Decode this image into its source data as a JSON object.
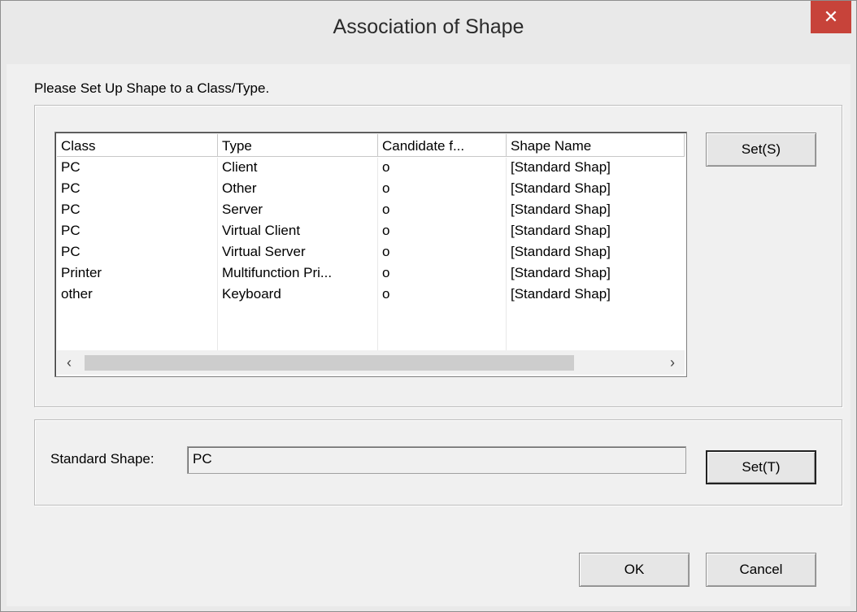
{
  "window": {
    "title": "Association of Shape",
    "close_glyph": "✕"
  },
  "instruction": "Please Set Up Shape to a Class/Type.",
  "table": {
    "columns": [
      "Class",
      "Type",
      "Candidate f...",
      "Shape Name"
    ],
    "rows": [
      [
        "PC",
        "Client",
        "o",
        "[Standard Shap]"
      ],
      [
        "PC",
        "Other",
        "o",
        "[Standard Shap]"
      ],
      [
        "PC",
        "Server",
        "o",
        "[Standard Shap]"
      ],
      [
        "PC",
        "Virtual Client",
        "o",
        "[Standard Shap]"
      ],
      [
        "PC",
        "Virtual Server",
        "o",
        "[Standard Shap]"
      ],
      [
        "Printer",
        "Multifunction Pri...",
        "o",
        "[Standard Shap]"
      ],
      [
        "other",
        "Keyboard",
        "o",
        "[Standard Shap]"
      ]
    ],
    "scroll_left_glyph": "‹",
    "scroll_right_glyph": "›"
  },
  "buttons": {
    "set_s": "Set(S)",
    "set_t": "Set(T)",
    "ok": "OK",
    "cancel": "Cancel"
  },
  "standard_shape": {
    "label": "Standard Shape:",
    "value": "PC"
  },
  "colors": {
    "close_button": "#c7433a",
    "dialog_bg": "#f0f0f0"
  }
}
